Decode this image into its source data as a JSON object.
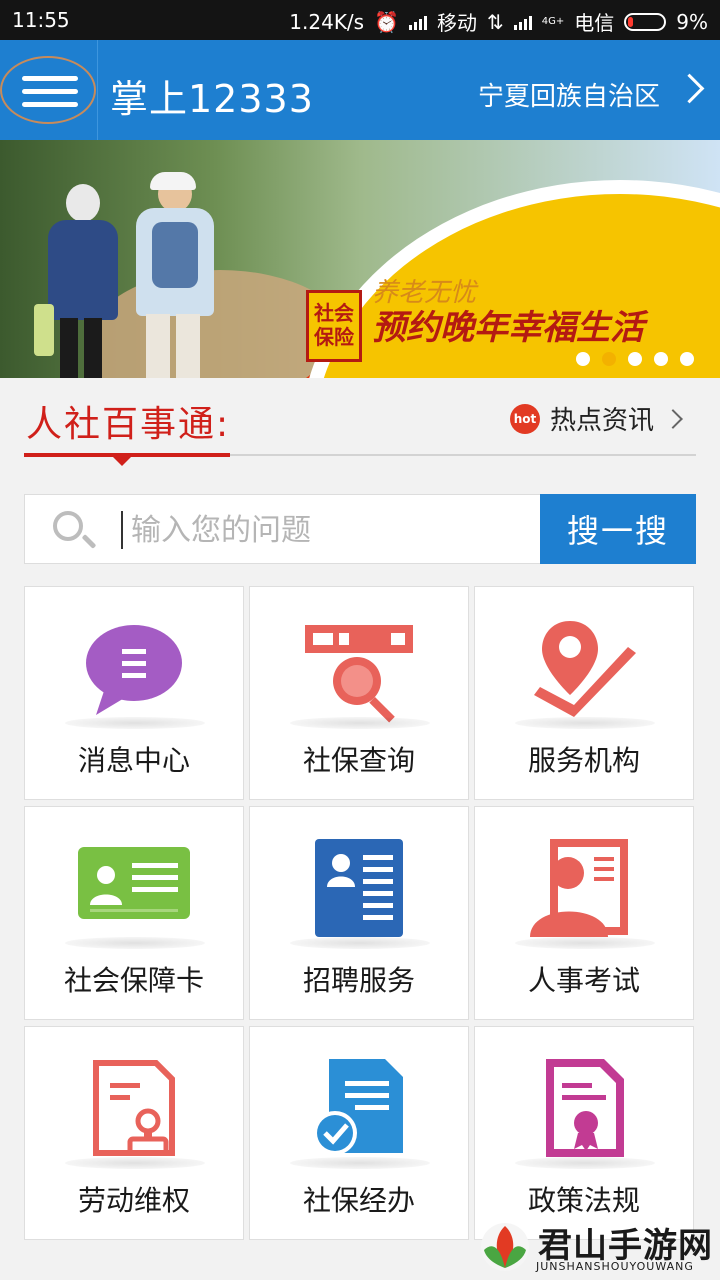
{
  "status_bar": {
    "time": "11:55",
    "speed": "1.24K/s",
    "carrier1": "移动",
    "network_type": "4G+",
    "carrier2": "电信",
    "battery": "9%"
  },
  "app_bar": {
    "title": "掌上12333",
    "region": "宁夏回族自治区"
  },
  "banner": {
    "seal_line1": "社会",
    "seal_line2": "保险",
    "slogan_small": "养老无忧",
    "slogan_main": "预约晚年幸福生活",
    "slide_count": 5,
    "active_slide": 1
  },
  "section": {
    "title": "人社百事通:",
    "hot_badge": "hot",
    "hot_label": "热点资讯"
  },
  "search": {
    "placeholder": "输入您的问题",
    "button_label": "搜一搜"
  },
  "grid": [
    {
      "label": "消息中心",
      "icon": "message-bubble-icon"
    },
    {
      "label": "社保查询",
      "icon": "card-search-icon"
    },
    {
      "label": "服务机构",
      "icon": "location-pin-icon"
    },
    {
      "label": "社会保障卡",
      "icon": "id-card-icon"
    },
    {
      "label": "招聘服务",
      "icon": "resume-icon"
    },
    {
      "label": "人事考试",
      "icon": "exam-person-icon"
    },
    {
      "label": "劳动维权",
      "icon": "stamp-document-icon"
    },
    {
      "label": "社保经办",
      "icon": "checked-document-icon"
    },
    {
      "label": "政策法规",
      "icon": "certificate-icon"
    }
  ],
  "watermark": {
    "name": "君山手游网",
    "sub": "JUNSHANSHOUYOUWANG"
  },
  "colors": {
    "primary": "#1e7fd0",
    "accent_red": "#d0201a",
    "icon_red": "#e8625a",
    "icon_purple": "#a45cc4",
    "icon_green": "#79c043",
    "icon_blue": "#2b67b5",
    "icon_magenta": "#c23b93"
  }
}
